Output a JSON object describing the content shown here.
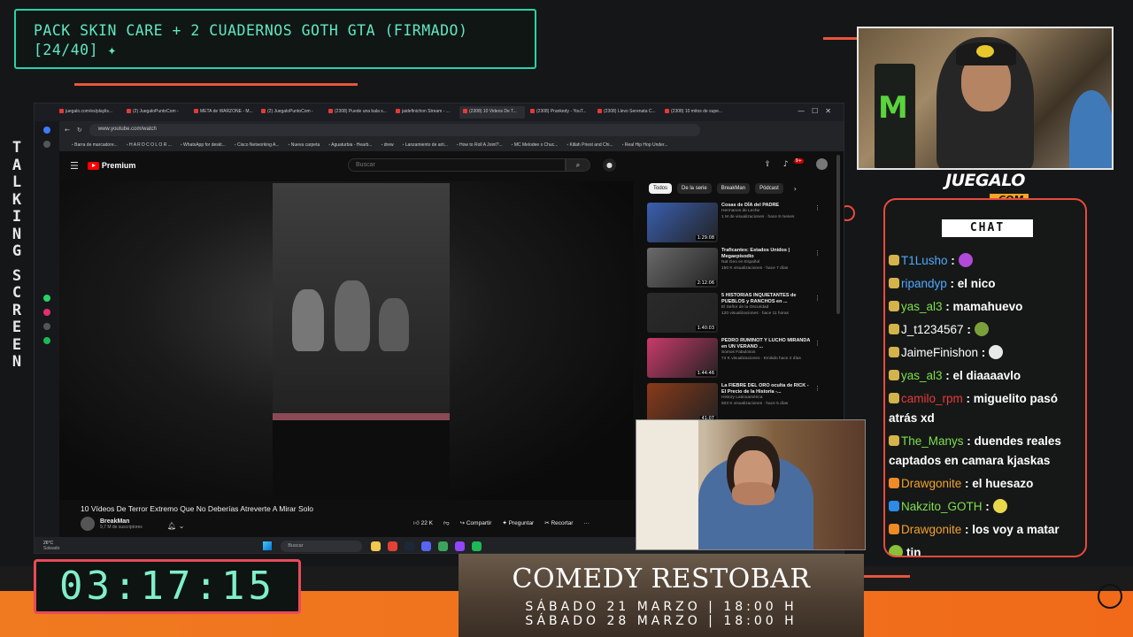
{
  "goal": {
    "line1": "PACK SKIN CARE + 2 CUADERNOS GOTH GTA (FIRMADO)",
    "line2": "[24/40]",
    "sparkle": "✦"
  },
  "side_text": [
    "T",
    "A",
    "L",
    "K",
    "I",
    "N",
    "G",
    "S",
    "C",
    "R",
    "E",
    "E",
    "N"
  ],
  "browser": {
    "tabs": [
      {
        "label": "juegalo.com/es/playlis..."
      },
      {
        "label": "(2) JuegaloPuntoCom -"
      },
      {
        "label": "META de WARZONE - M..."
      },
      {
        "label": "(2) JuegaloPuntoCom -"
      },
      {
        "label": "(2308) Puede una bala s..."
      },
      {
        "label": "jaidefinichon Stream - ..."
      },
      {
        "label": "(2308) 10 Videos De T...",
        "active": true
      },
      {
        "label": "(2308) Prankedy - YouT..."
      },
      {
        "label": "(2308) Llevo Serenata C..."
      },
      {
        "label": "(2308) 10 mitos de supe..."
      }
    ],
    "address": "www.youtube.com/watch",
    "bookmarks": [
      "Barra de marcadore...",
      "H A R D C O L O R ...",
      "WhatsApp for deskt...",
      "Cisco Networking A...",
      "Nueva carpeta",
      "Aguaturbia - Hearb...",
      "drew",
      "Lanzamiento de arti...",
      "How to Roll A Joint?...",
      "MC Melodee x Chuc...",
      "Killah Priest and Chi...",
      "Real Hip Hop Under..."
    ],
    "youtube": {
      "brand": "Premium",
      "search_placeholder": "Buscar",
      "notif_count": "9+",
      "video_title": "10 Vídeos De Terror Extremo Que No Deberías Atreverte A Mirar Solo",
      "channel_name": "BreakMan",
      "channel_subs": "9,7 M de suscriptores",
      "likes": "22 K",
      "share": "Compartir",
      "ask": "Preguntar",
      "clip": "Recortar",
      "chips": [
        "Todos",
        "De la serie",
        "BreakMan",
        "Pódcast"
      ],
      "recommendations": [
        {
          "title": "Cosas de DÍA del PADRE",
          "channel": "Hermanos de Leche",
          "meta": "1 M de visualizaciones · hace 8 meses",
          "duration": "1:29:08",
          "color": "#3a5fb0"
        },
        {
          "title": "Traficantes: Estados Unidos | Megaepisodio",
          "channel": "Nat Geo en Español",
          "meta": "150 K visualizaciones · hace 7 días",
          "duration": "2:12:06",
          "color": "#6a6a6a"
        },
        {
          "title": "5 HISTORIAS INQUIETANTES de PUEBLOS y RANCHOS en ...",
          "channel": "El Señor de la Oscuridad",
          "meta": "120 visualizaciones · hace 11 horas",
          "duration": "1:40:03",
          "color": "#2a2a2a"
        },
        {
          "title": "PEDRO RUMINOT Y LUCHO MIRANDA en UN VERANO ...",
          "channel": "Somos Fabulosos",
          "meta": "74 K visualizaciones · Emitido hace 2 días",
          "duration": "1:44:46",
          "color": "#c93a6a"
        },
        {
          "title": "La FIEBRE DEL ORO oculta de RICK - El Precio de la Historia -...",
          "channel": "History Latinoamérica",
          "meta": "503 K visualizaciones · hace 5 días",
          "duration": "41:07",
          "color": "#8a3a1a"
        }
      ]
    },
    "taskbar": {
      "temp": "26°C",
      "condition": "Soleado",
      "search": "Buscar"
    }
  },
  "brand": {
    "top": "JUEGALO",
    "bottom": ".COM"
  },
  "chat": {
    "title": "CHAT",
    "messages": [
      {
        "user": "T1Lusho",
        "text": "",
        "color": "#4fa8ff",
        "emote": "#b04ad8"
      },
      {
        "user": "ripandyp",
        "text": "el nico",
        "color": "#4fa8ff"
      },
      {
        "user": "yas_al3",
        "text": "mamahuevo",
        "color": "#7ee04a"
      },
      {
        "user": "J_t1234567",
        "text": "",
        "color": "#ffffff",
        "emote": "#7aa03a"
      },
      {
        "user": "JaimeFinishon",
        "text": "",
        "color": "#ffffff",
        "emote": "#e8e8e8"
      },
      {
        "user": "yas_al3",
        "text": "el diaaaavlo",
        "color": "#7ee04a"
      },
      {
        "user": "camilo_rpm",
        "text": "miguelito pasó atrás xd",
        "color": "#e83a3a"
      },
      {
        "user": "The_Manys",
        "text": "duendes reales captados en camara kjaskas",
        "color": "#7ee04a"
      },
      {
        "user": "Drawgonite",
        "text": "el huesazo",
        "color": "#f2a32a"
      },
      {
        "user": "Nakzito_GOTH",
        "text": "",
        "color": "#7ee04a",
        "emote": "#e8d84a"
      },
      {
        "user": "Drawgonite",
        "text": "los voy a matar",
        "color": "#f2a32a"
      },
      {
        "user": "",
        "text": "tin",
        "color": "#ffffff",
        "emote": "#8abf3a"
      }
    ]
  },
  "comedy": {
    "title": "COMEDY RESTOBAR",
    "date1": "SÁBADO 21 MARZO | 18:00 H",
    "date2": "SÁBADO 28 MARZO | 18:00 H"
  },
  "timer": "03:17:15"
}
